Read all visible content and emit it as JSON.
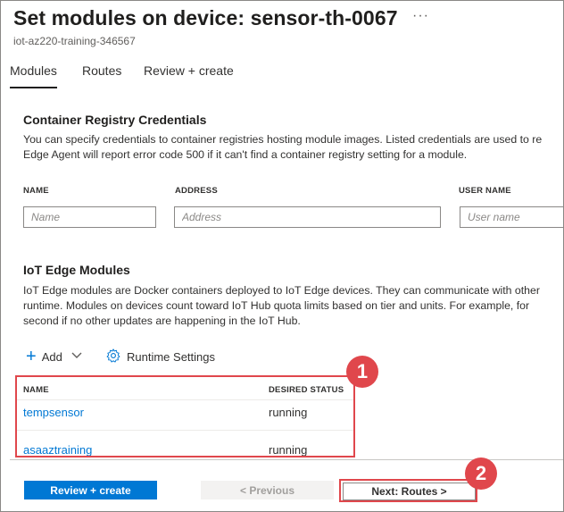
{
  "header": {
    "title": "Set modules on device: sensor-th-0067",
    "more_label": "···",
    "subtitle": "iot-az220-training-346567"
  },
  "tabs": [
    {
      "label": "Modules",
      "active": true
    },
    {
      "label": "Routes",
      "active": false
    },
    {
      "label": "Review + create",
      "active": false
    }
  ],
  "registry": {
    "title": "Container Registry Credentials",
    "desc_line1": "You can specify credentials to container registries hosting module images. Listed credentials are used to re",
    "desc_line2": "Edge Agent will report error code 500 if it can't find a container registry setting for a module.",
    "fields": [
      {
        "label": "NAME",
        "placeholder": "Name"
      },
      {
        "label": "ADDRESS",
        "placeholder": "Address"
      },
      {
        "label": "USER NAME",
        "placeholder": "User name"
      }
    ]
  },
  "modules": {
    "title": "IoT Edge Modules",
    "desc_line1": "IoT Edge modules are Docker containers deployed to IoT Edge devices. They can communicate with other",
    "desc_line2": "runtime. Modules on devices count toward IoT Hub quota limits based on tier and units. For example, for",
    "desc_line3": "second if no other updates are happening in the IoT Hub.",
    "toolbar": {
      "add_label": "Add",
      "runtime_label": "Runtime Settings"
    },
    "columns": [
      "NAME",
      "DESIRED STATUS"
    ],
    "rows": [
      {
        "name": "tempsensor",
        "status": "running"
      },
      {
        "name": "asaaztraining",
        "status": "running"
      }
    ]
  },
  "footer": {
    "review_label": "Review + create",
    "previous_label": "< Previous",
    "next_label": "Next: Routes >"
  },
  "annotations": {
    "badge1": "1",
    "badge2": "2",
    "color": "#e0474c"
  }
}
